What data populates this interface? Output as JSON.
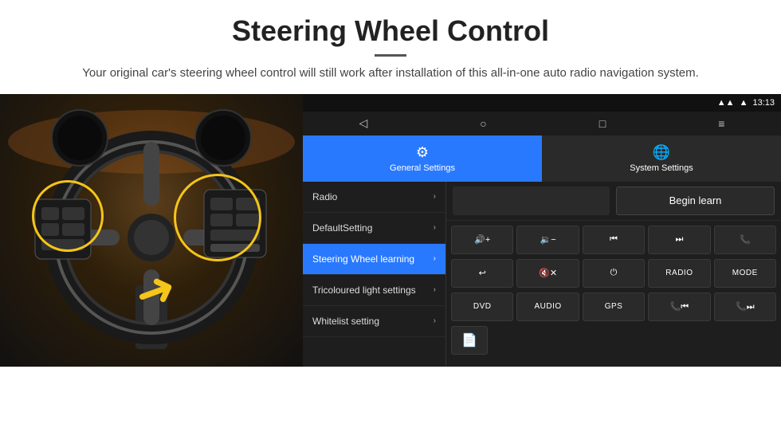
{
  "header": {
    "title": "Steering Wheel Control",
    "divider": "—",
    "subtitle": "Your original car's steering wheel control will still work after installation of this all-in-one auto radio navigation system."
  },
  "status_bar": {
    "signal_icon": "▾",
    "wifi_icon": "▾",
    "time": "13:13"
  },
  "nav_bar": {
    "back": "◁",
    "home": "○",
    "recent": "□",
    "menu": "≡"
  },
  "tabs": [
    {
      "id": "general",
      "label": "General Settings",
      "icon": "⚙",
      "active": true
    },
    {
      "id": "system",
      "label": "System Settings",
      "icon": "🌐",
      "active": false
    }
  ],
  "menu_items": [
    {
      "id": "radio",
      "label": "Radio",
      "active": false
    },
    {
      "id": "default",
      "label": "DefaultSetting",
      "active": false
    },
    {
      "id": "steering",
      "label": "Steering Wheel learning",
      "active": true
    },
    {
      "id": "tricoloured",
      "label": "Tricoloured light settings",
      "active": false
    },
    {
      "id": "whitelist",
      "label": "Whitelist setting",
      "active": false
    }
  ],
  "begin_learn_label": "Begin learn",
  "control_buttons": {
    "row1": [
      {
        "id": "vol-up",
        "label": "🔊+"
      },
      {
        "id": "vol-down",
        "label": "🔉−"
      },
      {
        "id": "prev-track",
        "label": "⏮"
      },
      {
        "id": "next-track",
        "label": "⏭"
      },
      {
        "id": "phone",
        "label": "📞"
      }
    ],
    "row2": [
      {
        "id": "hang-up",
        "label": "↩"
      },
      {
        "id": "mute",
        "label": "🔇✕"
      },
      {
        "id": "power",
        "label": "⏻"
      },
      {
        "id": "radio-btn",
        "label": "RADIO"
      },
      {
        "id": "mode-btn",
        "label": "MODE"
      }
    ],
    "row3": [
      {
        "id": "dvd-btn",
        "label": "DVD"
      },
      {
        "id": "audio-btn",
        "label": "AUDIO"
      },
      {
        "id": "gps-btn",
        "label": "GPS"
      },
      {
        "id": "tel-prev",
        "label": "📞⏮"
      },
      {
        "id": "tel-next",
        "label": "📞⏭"
      }
    ]
  },
  "file_btn_icon": "📄"
}
